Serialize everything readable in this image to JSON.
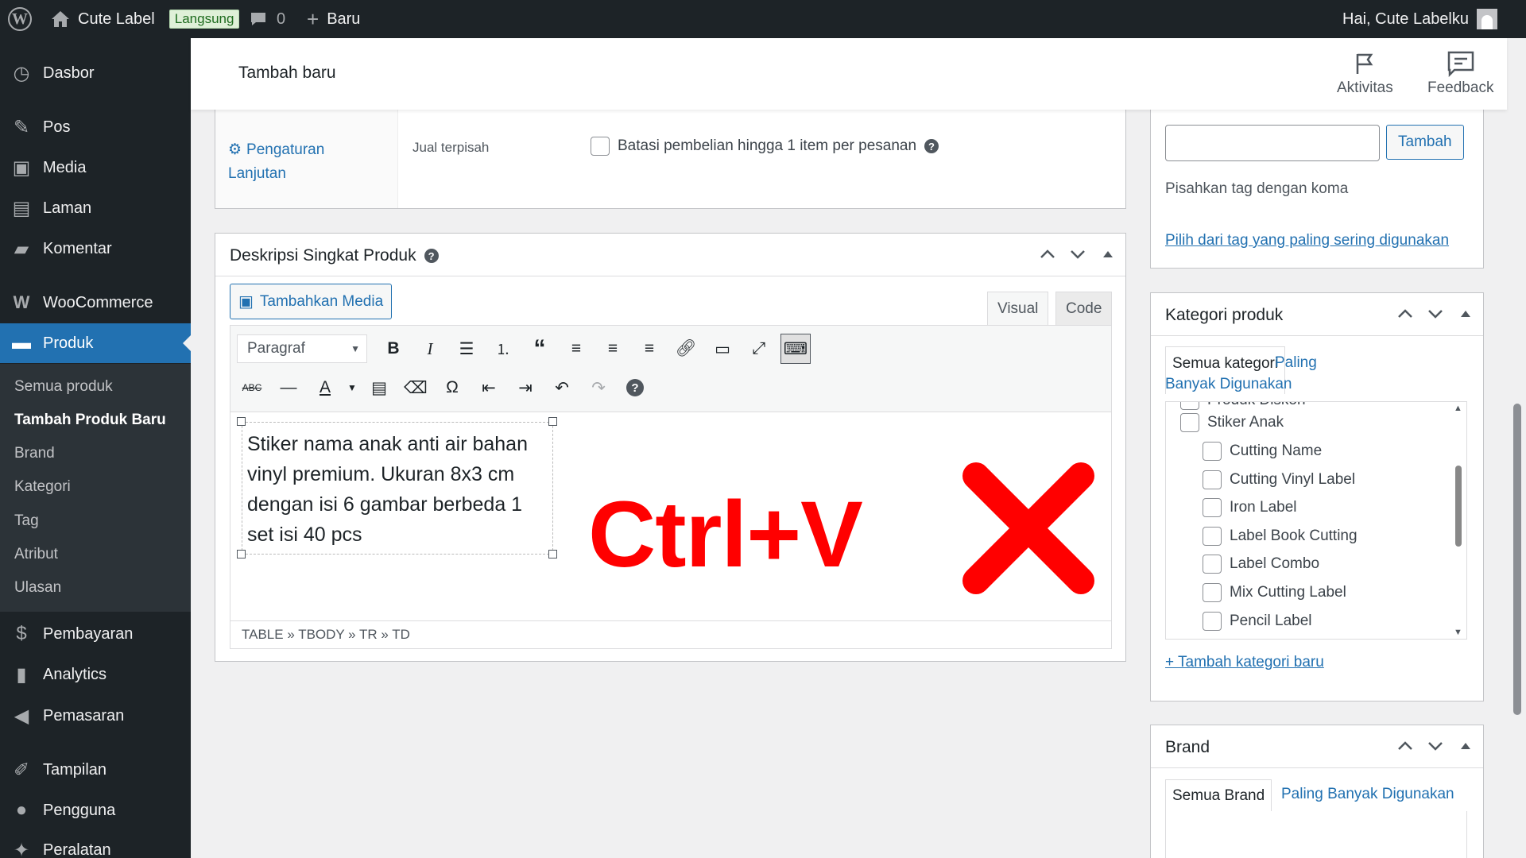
{
  "adminbar": {
    "site_name": "Cute Label",
    "live_badge": "Langsung",
    "comments_count": "0",
    "new_label": "Baru",
    "howdy": "Hai, Cute Labelku"
  },
  "sidebar": {
    "items": [
      {
        "label": "Dasbor",
        "icon": "dashboard-icon"
      },
      {
        "label": "Pos",
        "icon": "pin-icon"
      },
      {
        "label": "Media",
        "icon": "media-icon"
      },
      {
        "label": "Laman",
        "icon": "page-icon"
      },
      {
        "label": "Komentar",
        "icon": "comment-icon"
      },
      {
        "label": "WooCommerce",
        "icon": "woocommerce-icon"
      },
      {
        "label": "Produk",
        "icon": "archive-icon"
      },
      {
        "label": "Pembayaran",
        "icon": "dollar-icon"
      },
      {
        "label": "Analytics",
        "icon": "chart-icon"
      },
      {
        "label": "Pemasaran",
        "icon": "megaphone-icon"
      },
      {
        "label": "Tampilan",
        "icon": "brush-icon"
      },
      {
        "label": "Pengguna",
        "icon": "user-icon"
      },
      {
        "label": "Peralatan",
        "icon": "wrench-icon"
      }
    ],
    "submenu": [
      "Semua produk",
      "Tambah Produk Baru",
      "Brand",
      "Kategori",
      "Tag",
      "Atribut",
      "Ulasan"
    ]
  },
  "header": {
    "title": "Tambah baru",
    "activity": "Aktivitas",
    "feedback": "Feedback"
  },
  "advanced": {
    "link_line1": "Pengaturan",
    "link_line2": "Lanjutan",
    "field_label": "Jual terpisah",
    "checkbox_label": "Batasi pembelian hingga 1 item per pesanan"
  },
  "description": {
    "title": "Deskripsi Singkat Produk",
    "add_media": "Tambahkan Media",
    "tab_visual": "Visual",
    "tab_code": "Code",
    "format_select": "Paragraf",
    "content_lines": [
      "Stiker nama anak anti air bahan",
      "vinyl premium. Ukuran 8x3 cm",
      "dengan isi 6 gambar berbeda 1",
      "set isi 40 pcs"
    ],
    "overlay_text": "Ctrl+V",
    "path": "TABLE » TBODY » TR » TD"
  },
  "tags": {
    "add_button": "Tambah",
    "hint": "Pisahkan tag dengan koma",
    "choose_link": "Pilih dari tag yang paling sering digunakan"
  },
  "categories": {
    "title": "Kategori produk",
    "tab_all": "Semua kategori",
    "tab_popular_1": "Paling",
    "tab_popular_2": "Banyak Digunakan",
    "cut_item": "Produk Diskon",
    "items": [
      {
        "label": "Stiker Anak",
        "level": 0
      },
      {
        "label": "Cutting Name",
        "level": 1
      },
      {
        "label": "Cutting Vinyl Label",
        "level": 1
      },
      {
        "label": "Iron Label",
        "level": 1
      },
      {
        "label": "Label Book Cutting",
        "level": 1
      },
      {
        "label": "Label Combo",
        "level": 1
      },
      {
        "label": "Mix Cutting Label",
        "level": 1
      },
      {
        "label": "Pencil Label",
        "level": 1
      }
    ],
    "add_new": "+ Tambah kategori baru"
  },
  "brand": {
    "title": "Brand",
    "tab_all": "Semua Brand",
    "tab_popular": "Paling Banyak Digunakan"
  },
  "colors": {
    "admin_dark": "#1d2327",
    "accent": "#2271b1",
    "overlay_red": "#ff0000"
  }
}
